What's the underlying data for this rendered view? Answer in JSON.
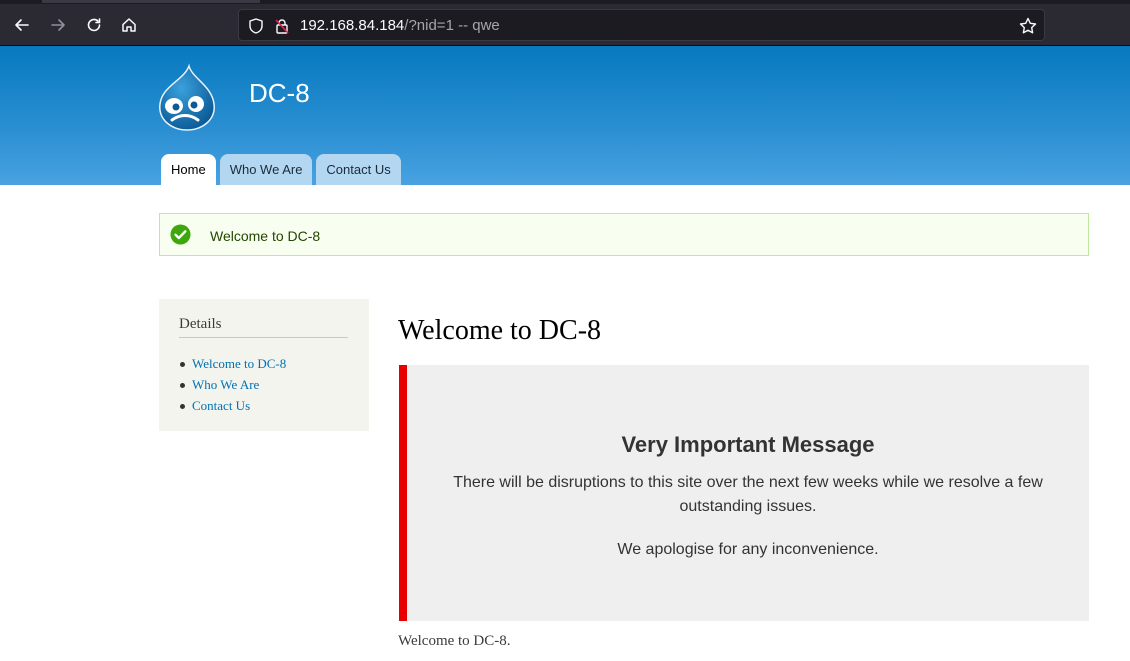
{
  "browser": {
    "url_host": "192.168.84.184",
    "url_path": "/?nid=1 -- qwe",
    "icons": [
      "back-icon",
      "forward-icon",
      "reload-icon",
      "home-icon",
      "shield-icon",
      "lock-icon",
      "star-icon"
    ]
  },
  "site": {
    "name": "DC-8",
    "tabs": [
      {
        "label": "Home",
        "active": true
      },
      {
        "label": "Who We Are",
        "active": false
      },
      {
        "label": "Contact Us",
        "active": false
      }
    ],
    "colors": {
      "header": "#0779bf",
      "link": "#0071b3",
      "notice_border": "#e80000"
    }
  },
  "status": {
    "message": "Welcome to DC-8"
  },
  "sidebar": {
    "title": "Details",
    "items": [
      {
        "label": "Welcome to DC-8"
      },
      {
        "label": "Who We Are"
      },
      {
        "label": "Contact Us"
      }
    ]
  },
  "main": {
    "title": "Welcome to DC-8",
    "notice": {
      "heading": "Very Important Message",
      "paragraph1": "There will be disruptions to this site over the next few weeks while we resolve a few outstanding issues.",
      "paragraph2": "We apologise for any inconvenience."
    },
    "body": "Welcome to DC-8."
  }
}
